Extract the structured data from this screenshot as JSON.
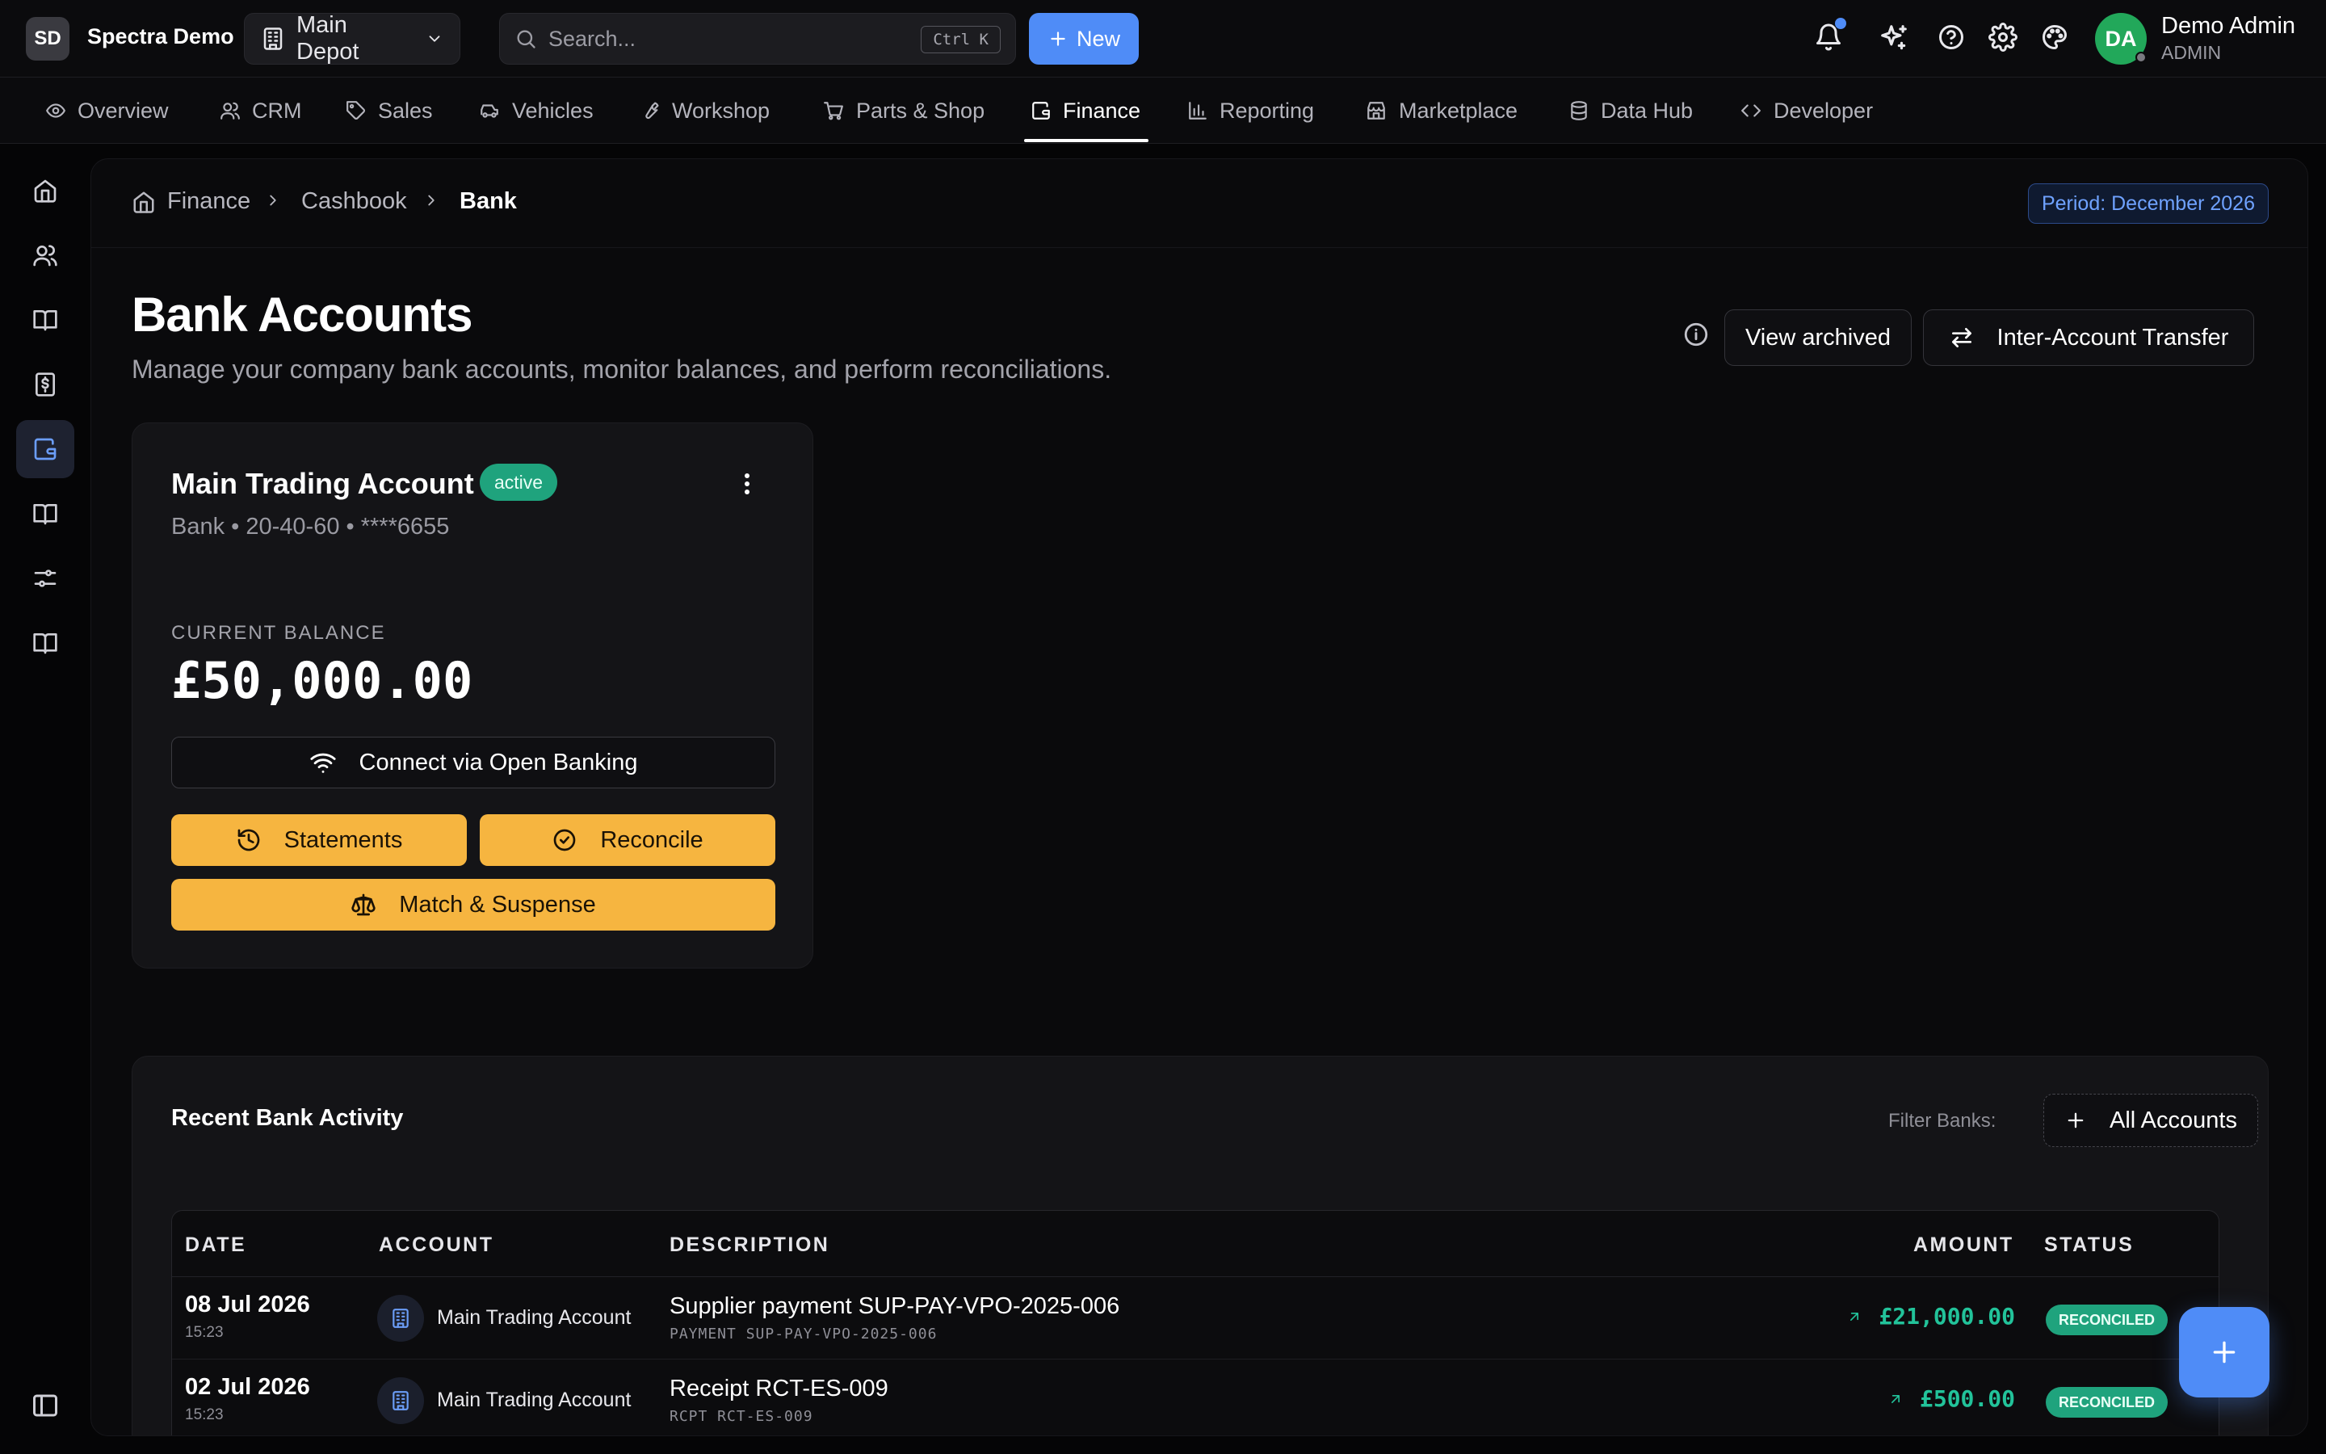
{
  "workspace": {
    "initials": "SD",
    "name": "Spectra Demo"
  },
  "location": {
    "label": "Main Depot"
  },
  "search": {
    "placeholder": "Search...",
    "shortcut": "Ctrl K"
  },
  "new_button": {
    "label": "New"
  },
  "user": {
    "initials": "DA",
    "name": "Demo Admin",
    "role": "ADMIN"
  },
  "nav": {
    "items": [
      {
        "label": "Overview",
        "icon": "eye-icon"
      },
      {
        "label": "CRM",
        "icon": "users-icon"
      },
      {
        "label": "Sales",
        "icon": "tag-icon"
      },
      {
        "label": "Vehicles",
        "icon": "car-icon"
      },
      {
        "label": "Workshop",
        "icon": "wrench-icon"
      },
      {
        "label": "Parts & Shop",
        "icon": "cart-icon"
      },
      {
        "label": "Finance",
        "icon": "wallet-icon",
        "active": true
      },
      {
        "label": "Reporting",
        "icon": "bar-chart-icon"
      },
      {
        "label": "Marketplace",
        "icon": "store-icon"
      },
      {
        "label": "Data Hub",
        "icon": "database-icon"
      },
      {
        "label": "Developer",
        "icon": "code-icon"
      }
    ]
  },
  "breadcrumb": {
    "root": "Finance",
    "middle": "Cashbook",
    "current": "Bank"
  },
  "period": {
    "label": "Period: December 2026"
  },
  "page": {
    "title": "Bank Accounts",
    "subtitle": "Manage your company bank accounts, monitor balances, and perform reconciliations.",
    "view_archived": "View archived",
    "transfer": "Inter-Account Transfer"
  },
  "account_card": {
    "name": "Main Trading Account",
    "status": "active",
    "meta": "Bank • 20-40-60 • ****6655",
    "balance_label": "CURRENT BALANCE",
    "balance": "£50,000.00",
    "connect": "Connect via Open Banking",
    "statements": "Statements",
    "reconcile": "Reconcile",
    "match": "Match & Suspense"
  },
  "activity": {
    "title": "Recent Bank Activity",
    "filter_label": "Filter Banks:",
    "filter_button": "All Accounts",
    "columns": {
      "date": "DATE",
      "account": "ACCOUNT",
      "description": "DESCRIPTION",
      "amount": "AMOUNT",
      "status": "STATUS"
    },
    "rows": [
      {
        "date": "08 Jul 2026",
        "time": "15:23",
        "account": "Main Trading Account",
        "description": "Supplier payment SUP-PAY-VPO-2025-006",
        "ref": "PAYMENT SUP-PAY-VPO-2025-006",
        "amount": "£21,000.00",
        "status": "RECONCILED"
      },
      {
        "date": "02 Jul 2026",
        "time": "15:23",
        "account": "Main Trading Account",
        "description": "Receipt RCT-ES-009",
        "ref": "RCPT RCT-ES-009",
        "amount": "£500.00",
        "status": "RECONCILED"
      }
    ]
  },
  "colors": {
    "accent": "#4f8cf7",
    "warning": "#f6b540",
    "success": "#1fa37d",
    "positive_amount": "#22c39a"
  }
}
